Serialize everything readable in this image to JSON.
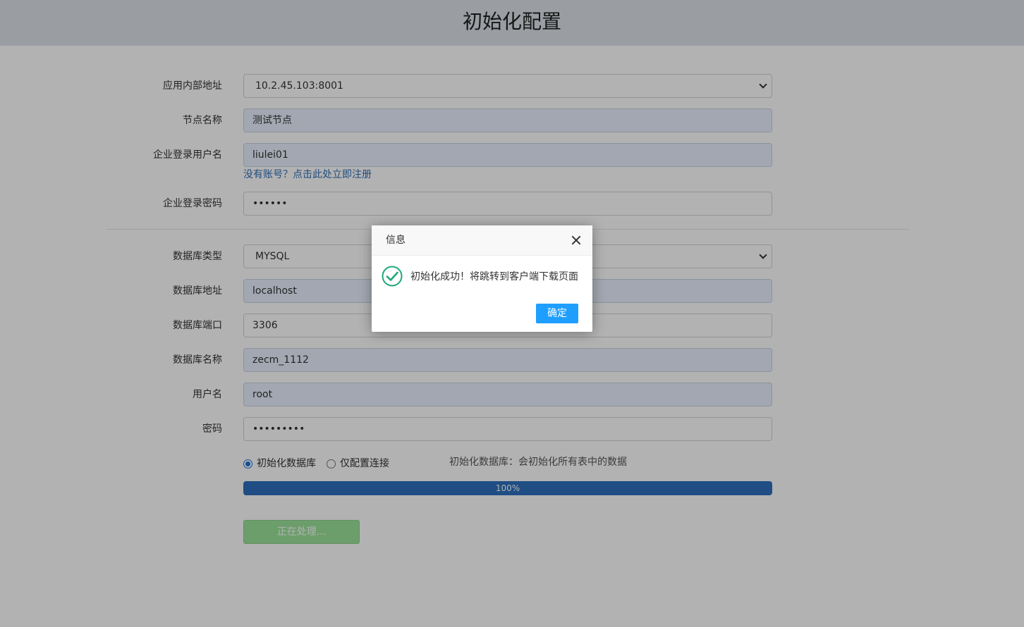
{
  "page": {
    "title": "初始化配置"
  },
  "form": {
    "app_address": {
      "label": "应用内部地址",
      "value": "10.2.45.103:8001"
    },
    "node_name": {
      "label": "节点名称",
      "value": "测试节点"
    },
    "login_user": {
      "label": "企业登录用户名",
      "value": "liulei01"
    },
    "register_link": "没有账号？点击此处立即注册",
    "login_password": {
      "label": "企业登录密码",
      "value": "••••••"
    },
    "db_type": {
      "label": "数据库类型",
      "value": "MYSQL"
    },
    "db_host": {
      "label": "数据库地址",
      "value": "localhost"
    },
    "db_port": {
      "label": "数据库端口",
      "value": "3306"
    },
    "db_name": {
      "label": "数据库名称",
      "value": "zecm_1112"
    },
    "db_user": {
      "label": "用户名",
      "value": "root"
    },
    "db_password": {
      "label": "密码",
      "value": "•••••••••"
    },
    "radio_init": "初始化数据库",
    "radio_config": "仅配置连接",
    "radio_note": "初始化数据库：会初始化所有表中的数据",
    "progress": {
      "value": 1.0,
      "text": "100%"
    },
    "submit_label": "正在处理..."
  },
  "dialog": {
    "title": "信息",
    "message": "初始化成功！将跳转到客户端下载页面",
    "confirm_label": "确定"
  },
  "colors": {
    "header_bg": "#dde3ea",
    "link": "#2f6db5",
    "progress": "#2d6fbd",
    "submit": "#9be29b",
    "dialog_button": "#1e9fff",
    "success_icon": "#1fa67a"
  },
  "icons": {
    "dropdown": "chevron-down-icon",
    "close": "close-icon",
    "success": "check-circle-icon"
  }
}
